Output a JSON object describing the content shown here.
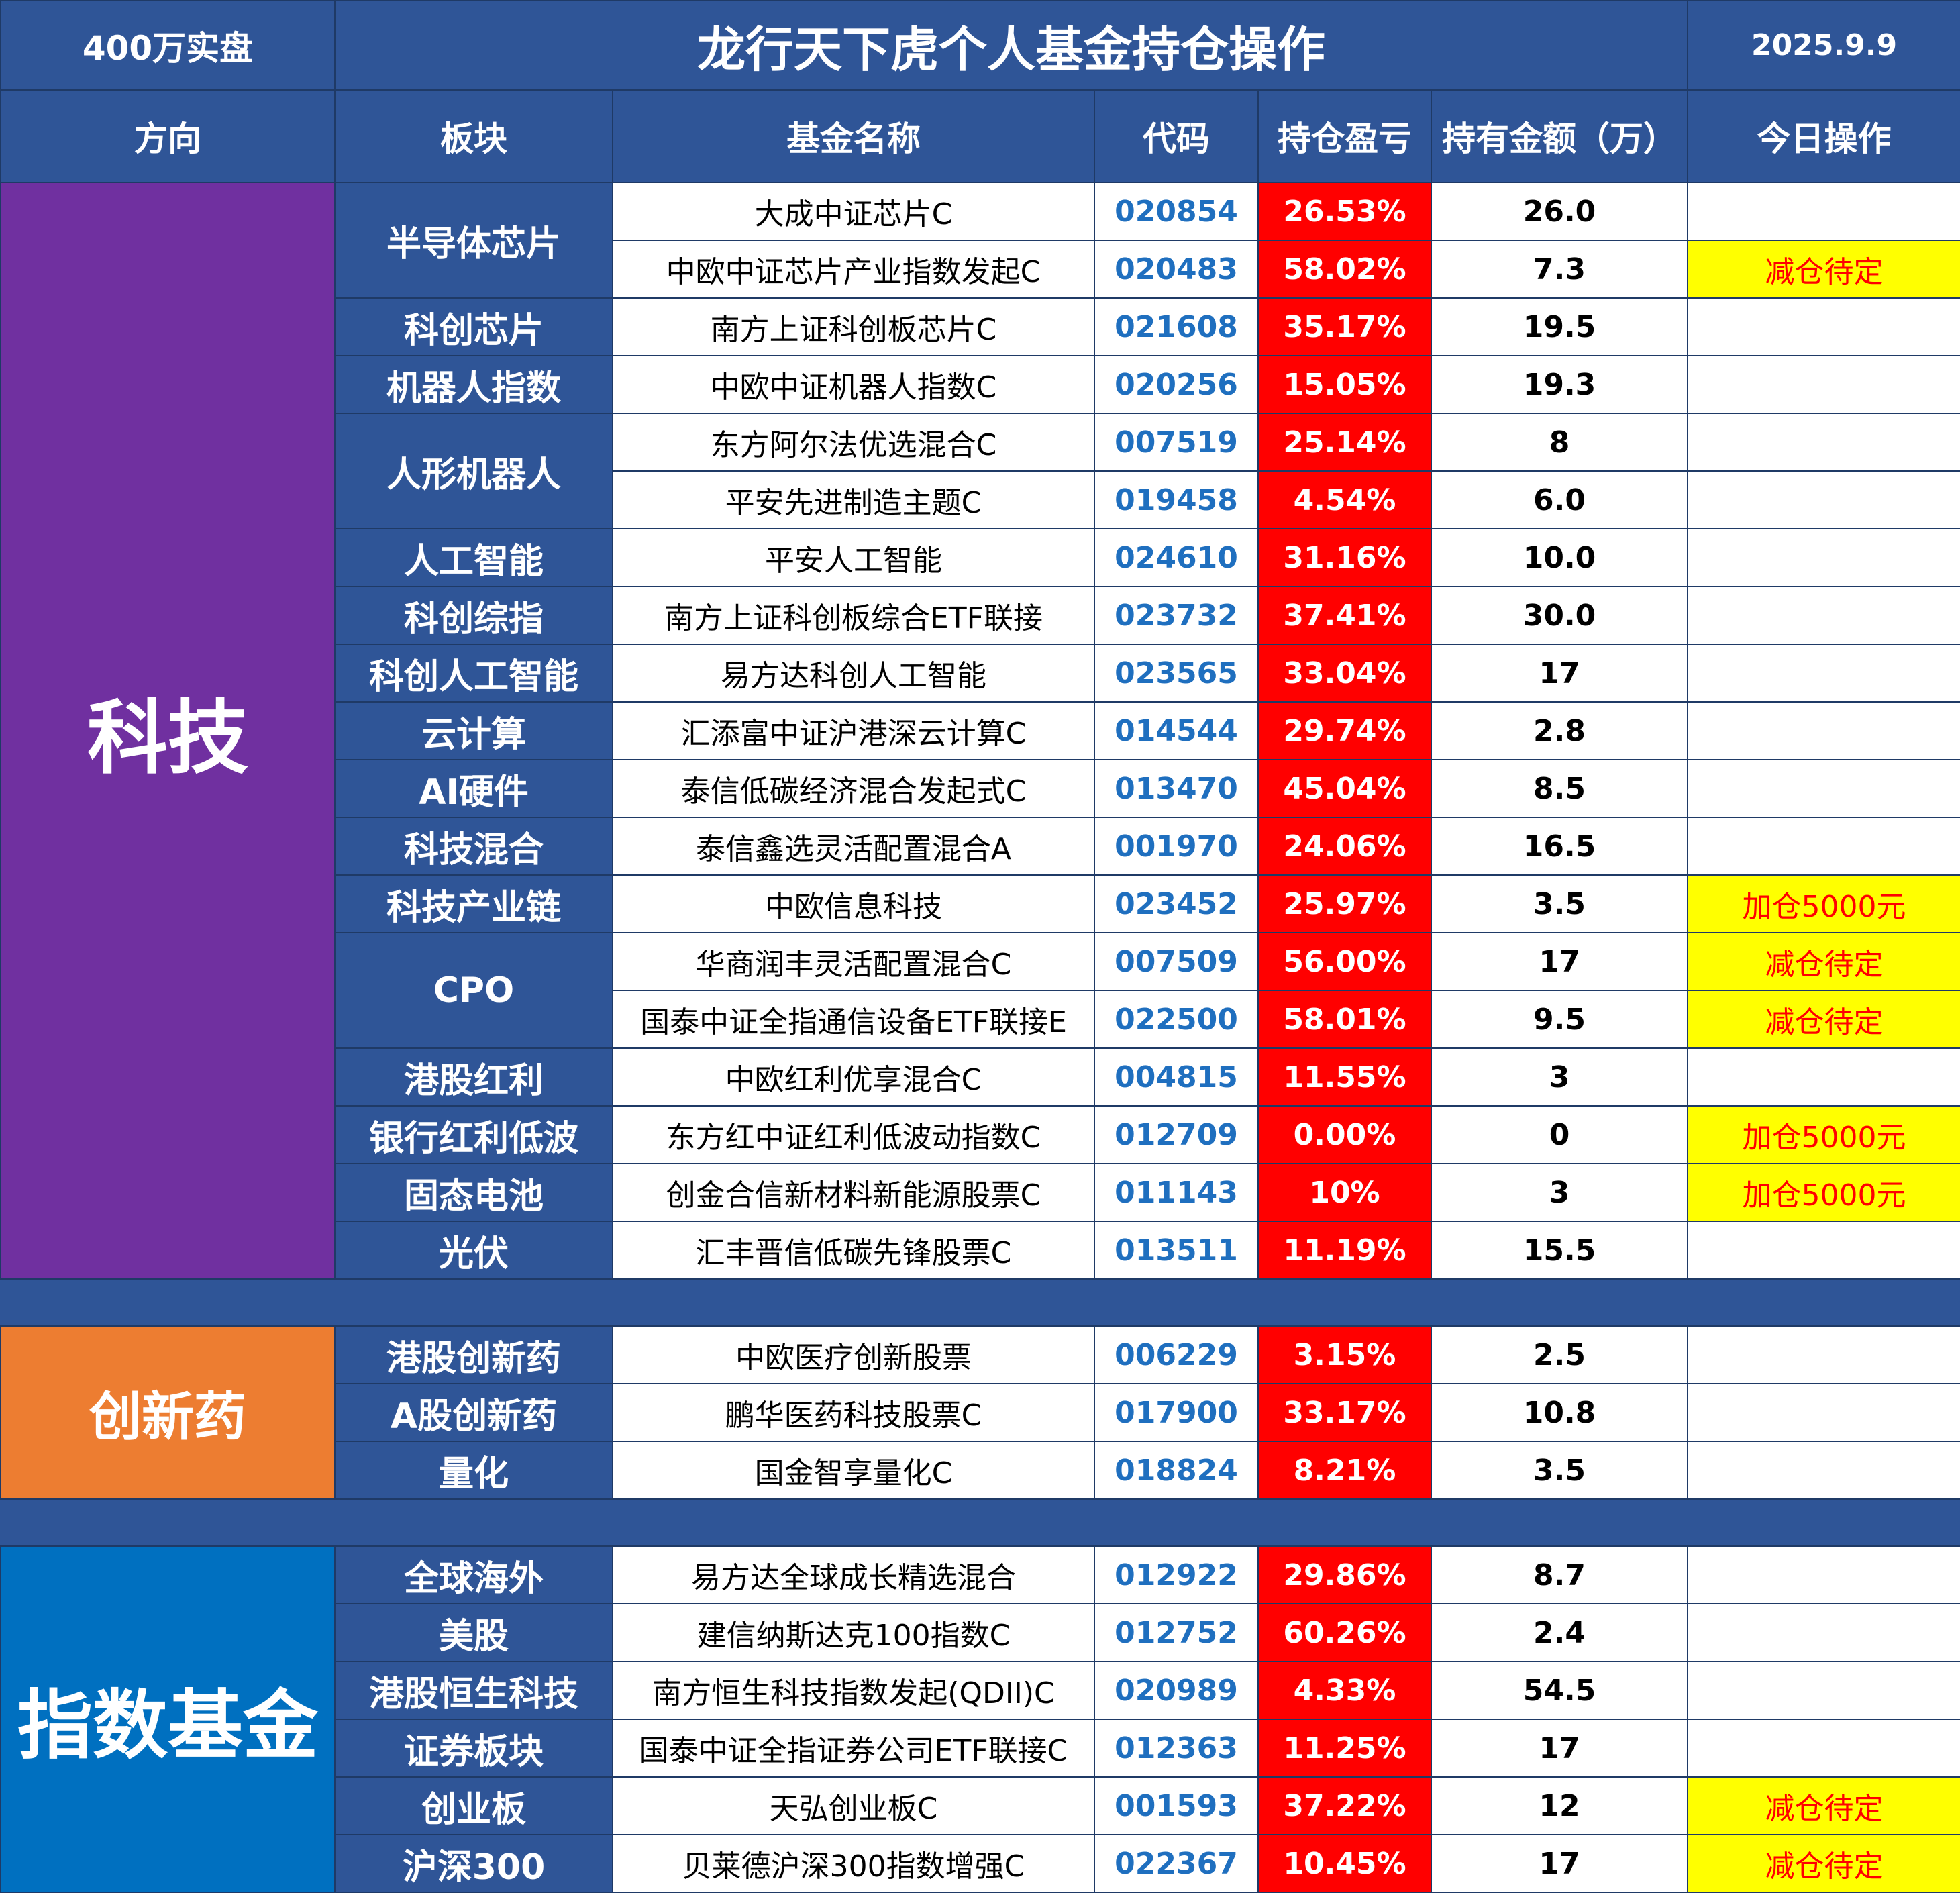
{
  "header": {
    "scale": "400万实盘",
    "title": "龙行天下虎个人基金持仓操作",
    "date": "2025.9.9"
  },
  "columns": {
    "direction": "方向",
    "sector": "板块",
    "fund": "基金名称",
    "code": "代码",
    "pnl": "持仓盈亏",
    "amount": "持有金额（万）",
    "op": "今日操作"
  },
  "directions": {
    "tech": "科技",
    "pharma": "创新药",
    "index": "指数基金"
  },
  "colors": {
    "tech": "#7030a0",
    "pharma": "#ed7d31",
    "index": "#0070c0",
    "header": "#2f5597",
    "loss_fill": "#ff0000",
    "highlight": "#ffff00"
  },
  "sectors": {
    "s1": "半导体芯片",
    "s2": "科创芯片",
    "s3": "机器人指数",
    "s4": "人形机器人",
    "s5": "人工智能",
    "s6": "科创综指",
    "s7": "科创人工智能",
    "s8": "云计算",
    "s9": "AI硬件",
    "s10": "科技混合",
    "s11": "科技产业链",
    "s12": "CPO",
    "s13": "港股红利",
    "s14": "银行红利低波",
    "s15": "固态电池",
    "s16": "光伏",
    "s17": "港股创新药",
    "s18": "A股创新药",
    "s19": "量化",
    "s20": "全球海外",
    "s21": "美股",
    "s22": "港股恒生科技",
    "s23": "证券板块",
    "s24": "创业板",
    "s25": "沪深300"
  },
  "rows": [
    {
      "fund": "大成中证芯片C",
      "code": "020854",
      "pnl": "26.53%",
      "amount": "26.0",
      "op": ""
    },
    {
      "fund": "中欧中证芯片产业指数发起C",
      "code": "020483",
      "pnl": "58.02%",
      "amount": "7.3",
      "op": "减仓待定"
    },
    {
      "fund": "南方上证科创板芯片C",
      "code": "021608",
      "pnl": "35.17%",
      "amount": "19.5",
      "op": ""
    },
    {
      "fund": "中欧中证机器人指数C",
      "code": "020256",
      "pnl": "15.05%",
      "amount": "19.3",
      "op": ""
    },
    {
      "fund": "东方阿尔法优选混合C",
      "code": "007519",
      "pnl": "25.14%",
      "amount": "8",
      "op": ""
    },
    {
      "fund": "平安先进制造主题C",
      "code": "019458",
      "pnl": "4.54%",
      "amount": "6.0",
      "op": ""
    },
    {
      "fund": "平安人工智能",
      "code": "024610",
      "pnl": "31.16%",
      "amount": "10.0",
      "op": ""
    },
    {
      "fund": "南方上证科创板综合ETF联接",
      "code": "023732",
      "pnl": "37.41%",
      "amount": "30.0",
      "op": ""
    },
    {
      "fund": "易方达科创人工智能",
      "code": "023565",
      "pnl": "33.04%",
      "amount": "17",
      "op": ""
    },
    {
      "fund": "汇添富中证沪港深云计算C",
      "code": "014544",
      "pnl": "29.74%",
      "amount": "2.8",
      "op": ""
    },
    {
      "fund": "泰信低碳经济混合发起式C",
      "code": "013470",
      "pnl": "45.04%",
      "amount": "8.5",
      "op": ""
    },
    {
      "fund": "泰信鑫选灵活配置混合A",
      "code": "001970",
      "pnl": "24.06%",
      "amount": "16.5",
      "op": ""
    },
    {
      "fund": "中欧信息科技",
      "code": "023452",
      "pnl": "25.97%",
      "amount": "3.5",
      "op": "加仓5000元"
    },
    {
      "fund": "华商润丰灵活配置混合C",
      "code": "007509",
      "pnl": "56.00%",
      "amount": "17",
      "op": "减仓待定"
    },
    {
      "fund": "国泰中证全指通信设备ETF联接E",
      "code": "022500",
      "pnl": "58.01%",
      "amount": "9.5",
      "op": "减仓待定"
    },
    {
      "fund": "中欧红利优享混合C",
      "code": "004815",
      "pnl": "11.55%",
      "amount": "3",
      "op": ""
    },
    {
      "fund": "东方红中证红利低波动指数C",
      "code": "012709",
      "pnl": "0.00%",
      "amount": "0",
      "op": "加仓5000元"
    },
    {
      "fund": "创金合信新材料新能源股票C",
      "code": "011143",
      "pnl": "10%",
      "amount": "3",
      "op": "加仓5000元"
    },
    {
      "fund": "汇丰晋信低碳先锋股票C",
      "code": "013511",
      "pnl": "11.19%",
      "amount": "15.5",
      "op": ""
    },
    {
      "fund": "中欧医疗创新股票",
      "code": "006229",
      "pnl": "3.15%",
      "amount": "2.5",
      "op": ""
    },
    {
      "fund": "鹏华医药科技股票C",
      "code": "017900",
      "pnl": "33.17%",
      "amount": "10.8",
      "op": ""
    },
    {
      "fund": "国金智享量化C",
      "code": "018824",
      "pnl": "8.21%",
      "amount": "3.5",
      "op": ""
    },
    {
      "fund": "易方达全球成长精选混合",
      "code": "012922",
      "pnl": "29.86%",
      "amount": "8.7",
      "op": ""
    },
    {
      "fund": "建信纳斯达克100指数C",
      "code": "012752",
      "pnl": "60.26%",
      "amount": "2.4",
      "op": ""
    },
    {
      "fund": "南方恒生科技指数发起(QDII)C",
      "code": "020989",
      "pnl": "4.33%",
      "amount": "54.5",
      "op": ""
    },
    {
      "fund": "国泰中证全指证券公司ETF联接C",
      "code": "012363",
      "pnl": "11.25%",
      "amount": "17",
      "op": ""
    },
    {
      "fund": "天弘创业板C",
      "code": "001593",
      "pnl": "37.22%",
      "amount": "12",
      "op": "减仓待定"
    },
    {
      "fund": "贝莱德沪深300指数增强C",
      "code": "022367",
      "pnl": "10.45%",
      "amount": "17",
      "op": "减仓待定"
    }
  ]
}
